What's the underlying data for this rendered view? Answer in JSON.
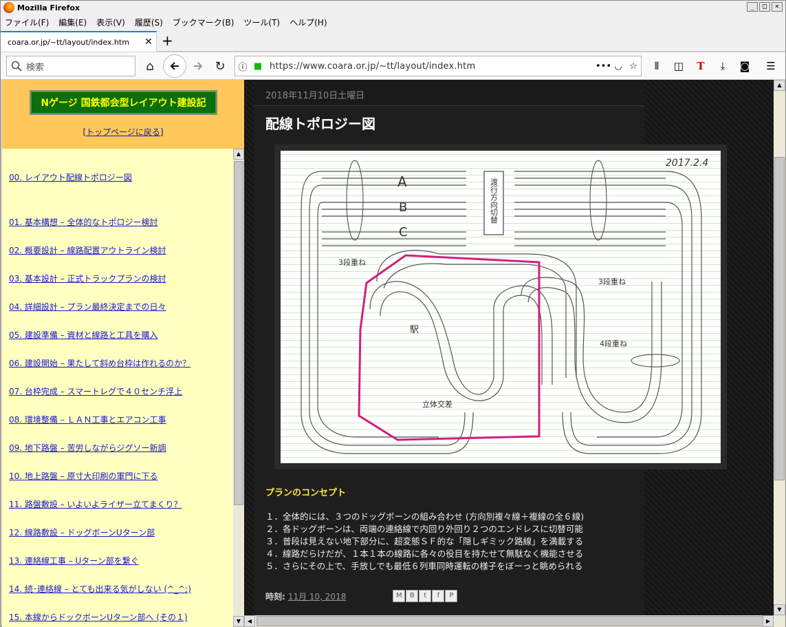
{
  "window": {
    "title": "Mozilla Firefox"
  },
  "menu": [
    "ファイル(F)",
    "編集(E)",
    "表示(V)",
    "履歴(S)",
    "ブックマーク(B)",
    "ツール(T)",
    "ヘルプ(H)"
  ],
  "tab": {
    "title": "coara.or.jp/~tt/layout/index.htm"
  },
  "nav": {
    "search_placeholder": "検索",
    "url": "https://www.coara.or.jp/~tt/layout/index.htm"
  },
  "sidebar": {
    "logo": "Nゲージ 国鉄都会型レイアウト建設記",
    "top_link": "[トップページに戻る]",
    "items": [
      "00. レイアウト配線トポロジー図",
      "01. 基本構想 – 全体的なトポロジー検討",
      "02. 概要設計 – 線路配置アウトライン検討",
      "03. 基本設計 – 正式トラックプランの検討",
      "04. 詳細設計 – プラン最終決定までの日々",
      "05. 建設準備 – 資材と線路と工具を購入",
      "06. 建設開始 – 果たして斜め台枠は作れるのか？",
      "07. 台枠完成 – スマートレグで４０センチ浮上",
      "08. 環境整備 – ＬＡＮ工事とエアコン工事",
      "09. 地下路盤 – 苦労しながらジグソー新調",
      "10. 地上路盤 – 原寸大印刷の軍門に下る",
      "11. 路盤敷設 – いよいよライザー立てまくり？",
      "12. 線路敷設 – ドッグボーンUターン部",
      "13. 連絡線工事 – Uターン部を繋ぐ",
      "14. 続･連絡線 – とても出来る気がしない (^_^;)",
      "15. 本線からドックボーンUターン部へ (その１)"
    ]
  },
  "post": {
    "date": "2018年11月10日土曜日",
    "title": "配線トポロジー図",
    "sketch": {
      "date": "2017.2.4",
      "labels": {
        "a": "A",
        "b": "B",
        "c": "C",
        "box": "渡行方向切替",
        "left3": "3段重ね",
        "right3": "3段重ね",
        "four": "4段重ね",
        "station": "駅",
        "cross": "立体交差"
      }
    },
    "concept_heading": "プランのコンセプト",
    "points": [
      "１．全体的には、３つのドッグボーンの組み合わせ (方向別複々線＋複線の全６線)",
      "２．各ドッグボーンは、両端の連絡線で内回り外回り２つのエンドレスに切替可能",
      "３．普段は見えない地下部分に、超変態ＳＦ的な「隠しギミック路線」を満載する",
      "４．線路だらけだが、１本１本の線路に各々の役目を持たせて無駄なく機能させる",
      "５．さらにその上で、手放しでも最低６列車同時運転の様子をぼーっと眺められる"
    ],
    "footer_label": "時刻:",
    "footer_date": "11月 10, 2018"
  }
}
